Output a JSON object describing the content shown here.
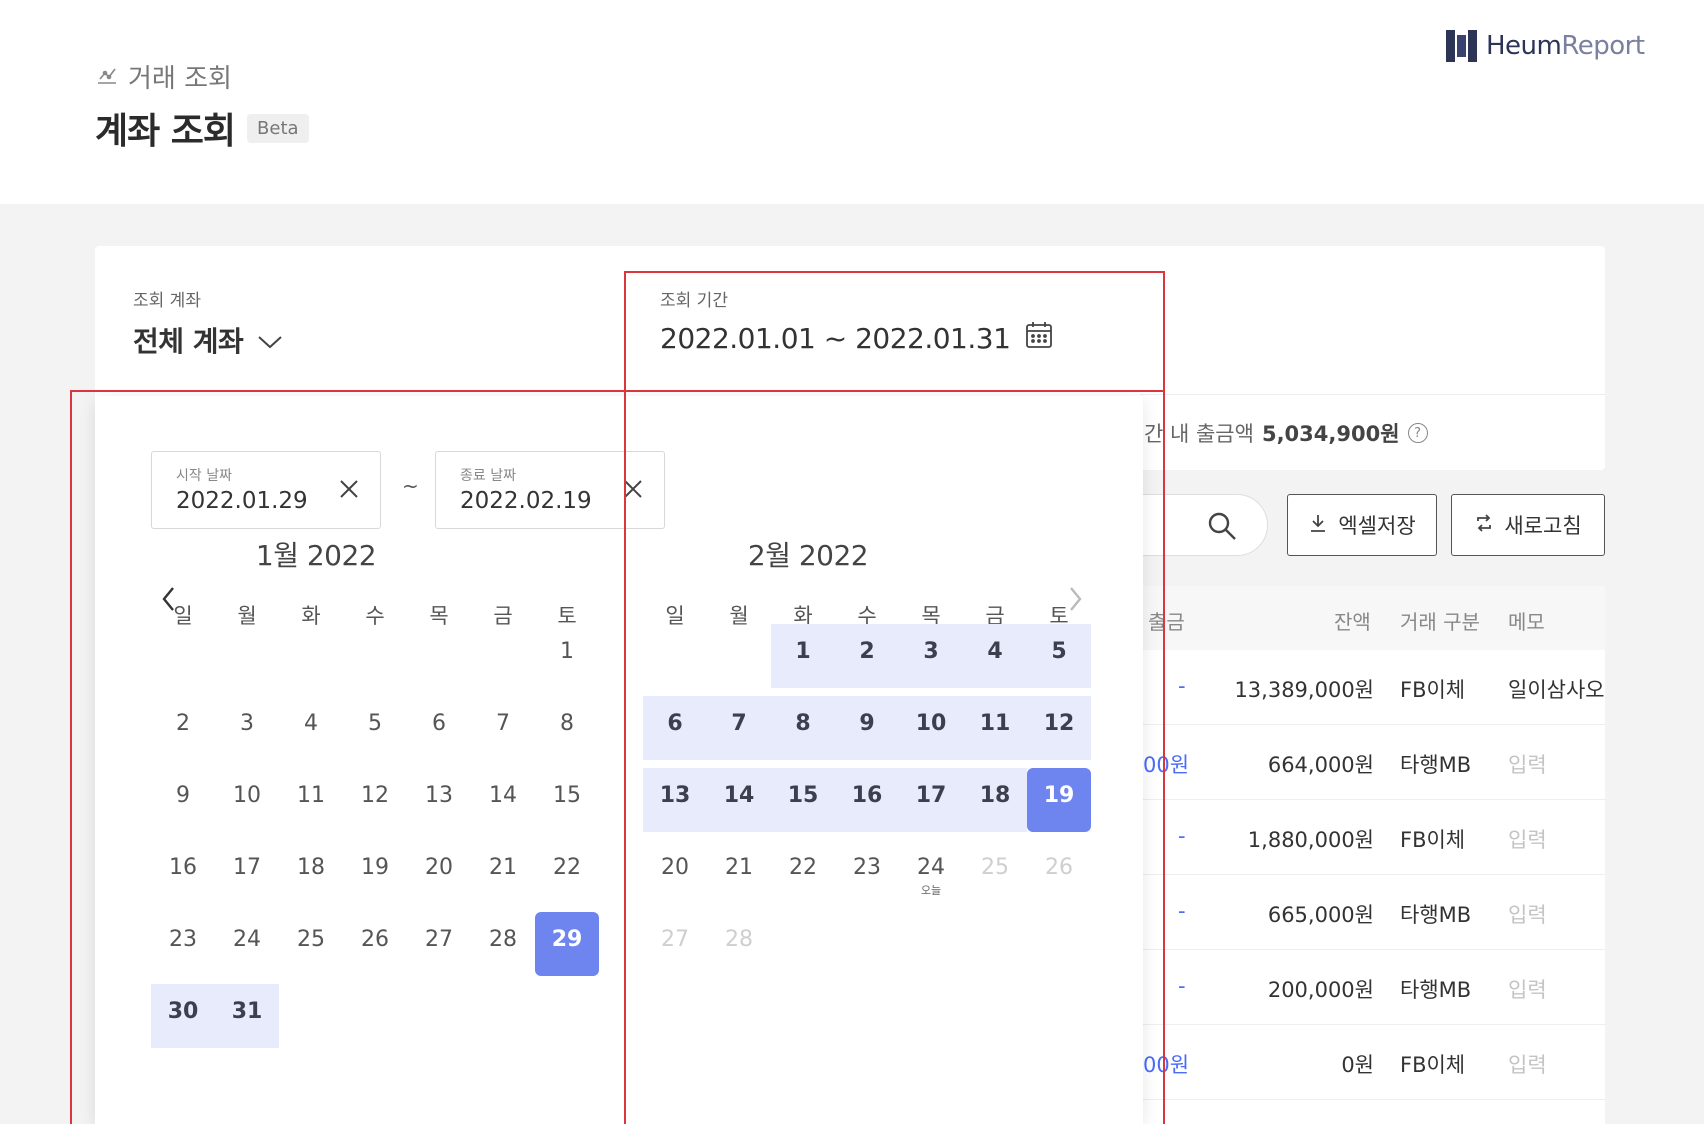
{
  "breadcrumb": {
    "parent": "거래 조회",
    "icon": "chart-icon"
  },
  "page": {
    "title": "계좌 조회",
    "badge": "Beta"
  },
  "logo": {
    "bold": "Heum",
    "light": "Report"
  },
  "filters": {
    "account_label": "조회 계좌",
    "account_value": "전체 계좌",
    "period_label": "조회 기간",
    "period_value": "2022.01.01 ~ 2022.01.31"
  },
  "summary": {
    "text": "간 내 출금액",
    "amount": "5,034,900원"
  },
  "toolbar": {
    "excel_label": "엑셀저장",
    "refresh_label": "새로고침"
  },
  "table": {
    "headers": {
      "withdraw": "출금",
      "balance": "잔액",
      "type": "거래 구분",
      "memo": "메모"
    },
    "rows": [
      {
        "withdraw": "-",
        "balance": "13,389,000원",
        "type": "FB이체",
        "memo": "일이삼사오",
        "memo_placeholder": false
      },
      {
        "withdraw": "00원",
        "balance": "664,000원",
        "type": "타행MB",
        "memo": "입력",
        "memo_placeholder": true
      },
      {
        "withdraw": "-",
        "balance": "1,880,000원",
        "type": "FB이체",
        "memo": "입력",
        "memo_placeholder": true
      },
      {
        "withdraw": "-",
        "balance": "665,000원",
        "type": "타행MB",
        "memo": "입력",
        "memo_placeholder": true
      },
      {
        "withdraw": "-",
        "balance": "200,000원",
        "type": "타행MB",
        "memo": "입력",
        "memo_placeholder": true
      },
      {
        "withdraw": "00원",
        "balance": "0원",
        "type": "FB이체",
        "memo": "입력",
        "memo_placeholder": true
      }
    ]
  },
  "datepicker": {
    "start": {
      "label": "시작 날짜",
      "value": "2022.01.29"
    },
    "end": {
      "label": "종료 날짜",
      "value": "2022.02.19"
    },
    "separator": "~",
    "weekdays": [
      "일",
      "월",
      "화",
      "수",
      "목",
      "금",
      "토"
    ],
    "today_label": "오늘",
    "months": [
      {
        "title": "1월 2022",
        "first_weekday": 6,
        "days": 31,
        "range_from": 29,
        "range_to": 31,
        "endpoint_days": [
          29
        ],
        "today": null,
        "disabled_from": null
      },
      {
        "title": "2월 2022",
        "first_weekday": 2,
        "days": 28,
        "range_from": 1,
        "range_to": 19,
        "endpoint_days": [
          19
        ],
        "today": 24,
        "disabled_from": 25
      }
    ]
  },
  "colors": {
    "accent": "#6e85f0",
    "range": "#e8ebfc",
    "highlight": "#d9363e"
  }
}
